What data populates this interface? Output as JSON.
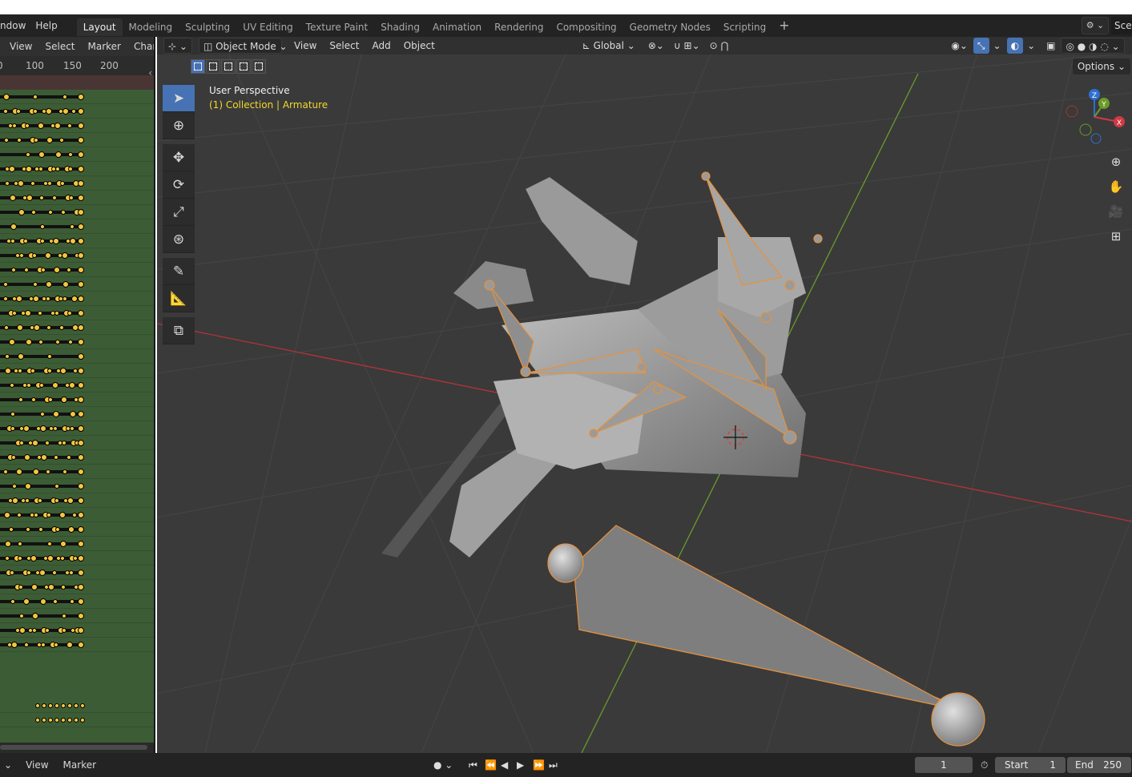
{
  "topbar": {
    "menus": [
      "ndow",
      "Help"
    ],
    "workspaces": [
      "Layout",
      "Modeling",
      "Sculpting",
      "UV Editing",
      "Texture Paint",
      "Shading",
      "Animation",
      "Rendering",
      "Compositing",
      "Geometry Nodes",
      "Scripting"
    ],
    "active_workspace": "Layout",
    "add_tab": "+",
    "scene_name": "Sce"
  },
  "dopesheet": {
    "menus": [
      "View",
      "Select",
      "Marker",
      "Channel"
    ],
    "ruler": [
      "0",
      "100",
      "150",
      "200"
    ],
    "collapse_glyph": "‹"
  },
  "viewport": {
    "mode": "Object Mode",
    "menus": [
      "View",
      "Select",
      "Add",
      "Object"
    ],
    "orientation": "Global",
    "overlay_title": "User Perspective",
    "overlay_subtitle": "(1) Collection | Armature",
    "options_label": "Options",
    "gizmo_axes": [
      "Z",
      "Y",
      "X"
    ]
  },
  "timeline": {
    "menus": [
      "View",
      "Marker"
    ],
    "current_frame": "1",
    "start_label": "Start",
    "start_value": "1",
    "end_label": "End",
    "end_value": "250"
  },
  "colors": {
    "accent": "#4772b3",
    "selection_outline": "#e8913a",
    "keyframe": "#f5c542",
    "channel_bg": "#3c5c35",
    "x_axis": "#b5323a",
    "y_axis": "#6b9a2a"
  }
}
